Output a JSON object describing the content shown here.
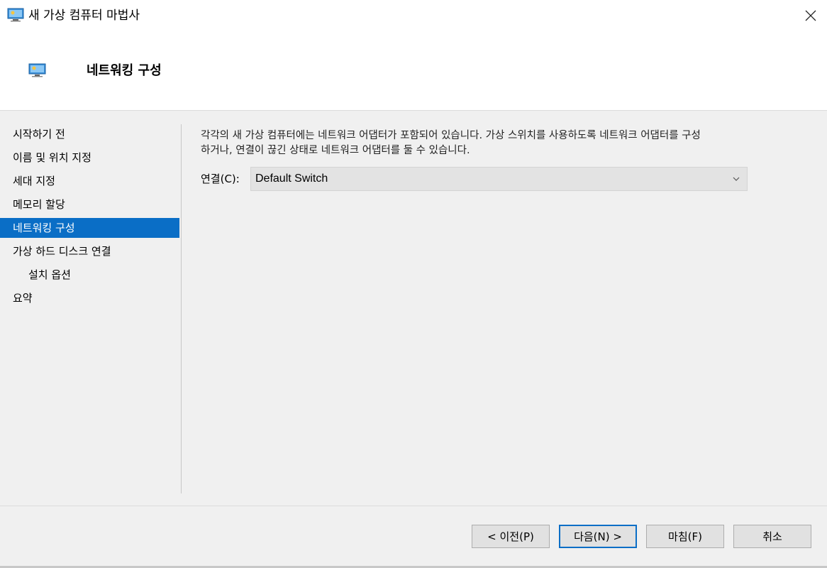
{
  "window": {
    "title": "새 가상 컴퓨터 마법사"
  },
  "header": {
    "title": "네트워킹 구성"
  },
  "nav": {
    "items": [
      {
        "label": "시작하기 전"
      },
      {
        "label": "이름 및 위치 지정"
      },
      {
        "label": "세대 지정"
      },
      {
        "label": "메모리 할당"
      },
      {
        "label": "네트워킹 구성"
      },
      {
        "label": "가상 하드 디스크 연결"
      },
      {
        "label": "설치 옵션"
      },
      {
        "label": "요약"
      }
    ],
    "active_index": 4
  },
  "main": {
    "description_line1": "각각의 새 가상 컴퓨터에는 네트워크 어댑터가 포함되어 있습니다. 가상 스위치를 사용하도록 네트워크 어댑터를 구성",
    "description_line2": "하거나, 연결이 끊긴 상태로 네트워크 어댑터를 둘 수 있습니다.",
    "connection_label": "연결(C):",
    "connection_value": "Default Switch"
  },
  "buttons": {
    "previous": "< 이전(P)",
    "next": "다음(N) >",
    "finish": "마침(F)",
    "cancel": "취소"
  },
  "colors": {
    "accent": "#0a6ec6",
    "window_bg": "#f0f0f0",
    "header_bg": "#ffffff"
  }
}
